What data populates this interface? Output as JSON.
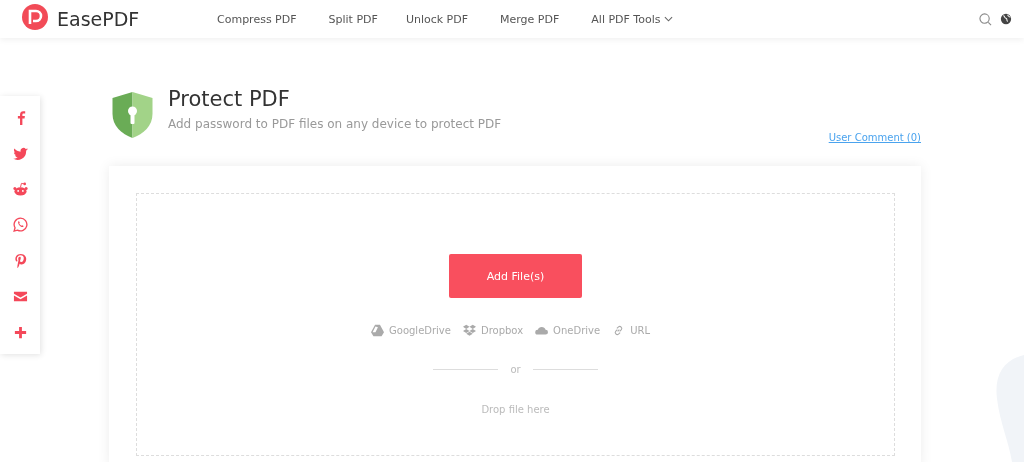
{
  "header": {
    "brand": "EasePDF",
    "nav": [
      {
        "label": "Compress PDF",
        "dropdown": false
      },
      {
        "label": "Split PDF",
        "dropdown": false
      },
      {
        "label": "Unlock PDF",
        "dropdown": false
      },
      {
        "label": "Merge PDF",
        "dropdown": false
      },
      {
        "label": "All PDF Tools",
        "dropdown": true
      }
    ]
  },
  "share": [
    {
      "kind": "facebook"
    },
    {
      "kind": "twitter"
    },
    {
      "kind": "reddit"
    },
    {
      "kind": "whatsapp"
    },
    {
      "kind": "pinterest"
    },
    {
      "kind": "email"
    },
    {
      "kind": "more"
    }
  ],
  "tool": {
    "title": "Protect PDF",
    "subtitle": "Add password to PDF files on any device to protect PDF",
    "comment_link": "User Comment (0)"
  },
  "upload": {
    "button": "Add File(s)",
    "sources": [
      {
        "kind": "googledrive",
        "label": "GoogleDrive"
      },
      {
        "kind": "dropbox",
        "label": "Dropbox"
      },
      {
        "kind": "onedrive",
        "label": "OneDrive"
      },
      {
        "kind": "url",
        "label": "URL"
      }
    ],
    "separator": "or",
    "drop_hint": "Drop file here"
  }
}
